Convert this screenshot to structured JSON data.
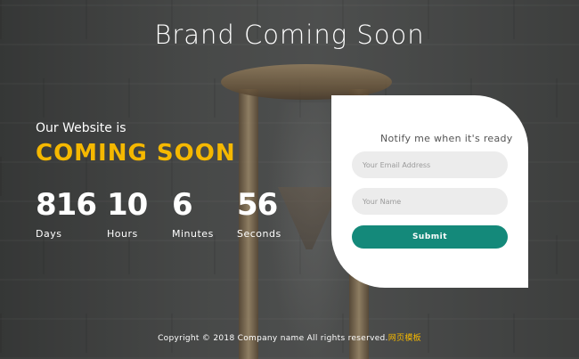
{
  "header": {
    "title": "Brand Coming Soon"
  },
  "hero": {
    "subtitle": "Our Website is",
    "headline": "COMING SOON",
    "headline_color": "#f5b800"
  },
  "countdown": [
    {
      "value": "816",
      "label": "Days"
    },
    {
      "value": "10",
      "label": "Hours"
    },
    {
      "value": "6",
      "label": "Minutes"
    },
    {
      "value": "56",
      "label": "Seconds"
    }
  ],
  "form": {
    "heading": "Notify me when it's ready",
    "email_placeholder": "Your Email Address",
    "name_placeholder": "Your Name",
    "submit_label": "Submit",
    "accent_color": "#14897a"
  },
  "footer": {
    "copyright": "Copyright © 2018 Company name All rights reserved.",
    "link_label": "网页模板"
  }
}
